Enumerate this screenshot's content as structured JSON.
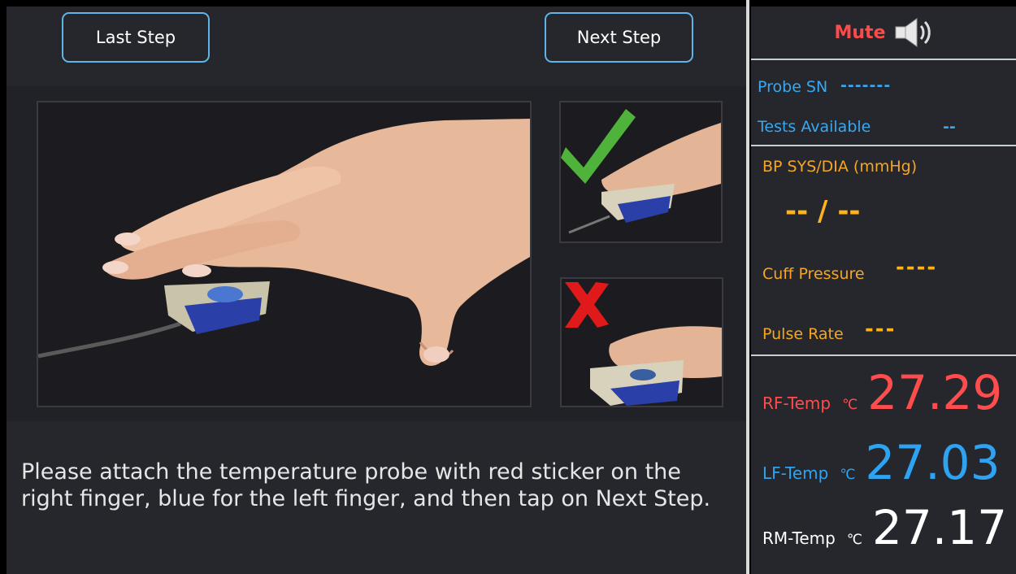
{
  "nav": {
    "last_step": "Last Step",
    "next_step": "Next Step"
  },
  "instruction": "Please attach the temperature probe with red sticker on the right finger, blue for the left finger, and then tap on Next Step.",
  "side": {
    "mute_label": "Mute",
    "probe_sn_label": "Probe SN",
    "probe_sn_value": "-------",
    "tests_available_label": "Tests Available",
    "tests_available_value": "--",
    "bp_label": "BP SYS/DIA  (mmHg)",
    "bp_value": "-- / --",
    "cuff_pressure_label": "Cuff Pressure",
    "cuff_pressure_value": "----",
    "pulse_rate_label": "Pulse Rate",
    "pulse_rate_value": "---",
    "temps": [
      {
        "label": "RF-Temp",
        "unit": "℃",
        "value": "27.29",
        "color": "#ff4d4d"
      },
      {
        "label": "LF-Temp",
        "unit": "℃",
        "value": "27.03",
        "color": "#2ea3f2"
      },
      {
        "label": "RM-Temp",
        "unit": "℃",
        "value": "27.17",
        "color": "#ffffff"
      }
    ]
  },
  "icons": {
    "speaker": "speaker-icon",
    "check": "check-icon",
    "cross": "cross-icon"
  },
  "colors": {
    "accent_border": "#5fb6e6",
    "mute": "#ff4a4a",
    "label_blue": "#3aa7f0",
    "label_orange": "#f5a623"
  }
}
